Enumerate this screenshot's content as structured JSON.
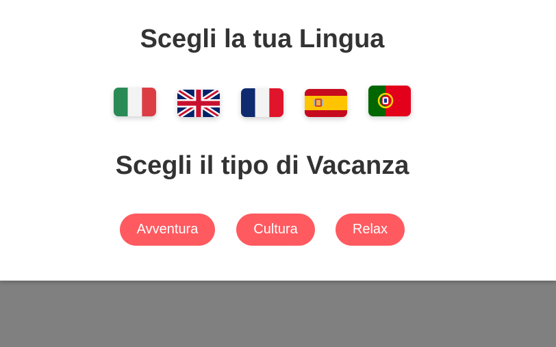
{
  "language_section": {
    "title": "Scegli la tua Lingua",
    "flags": [
      {
        "icon": "italy-flag-icon"
      },
      {
        "icon": "uk-flag-icon"
      },
      {
        "icon": "france-flag-icon"
      },
      {
        "icon": "spain-flag-icon"
      },
      {
        "icon": "portugal-flag-icon"
      }
    ]
  },
  "vacation_section": {
    "title": "Scegli il tipo di Vacanza",
    "buttons": [
      {
        "label": "Avventura"
      },
      {
        "label": "Cultura"
      },
      {
        "label": "Relax"
      }
    ]
  },
  "colors": {
    "button_bg": "#ff5a60",
    "button_text": "#ffffff",
    "heading": "#333333",
    "overlay": "#808080"
  }
}
